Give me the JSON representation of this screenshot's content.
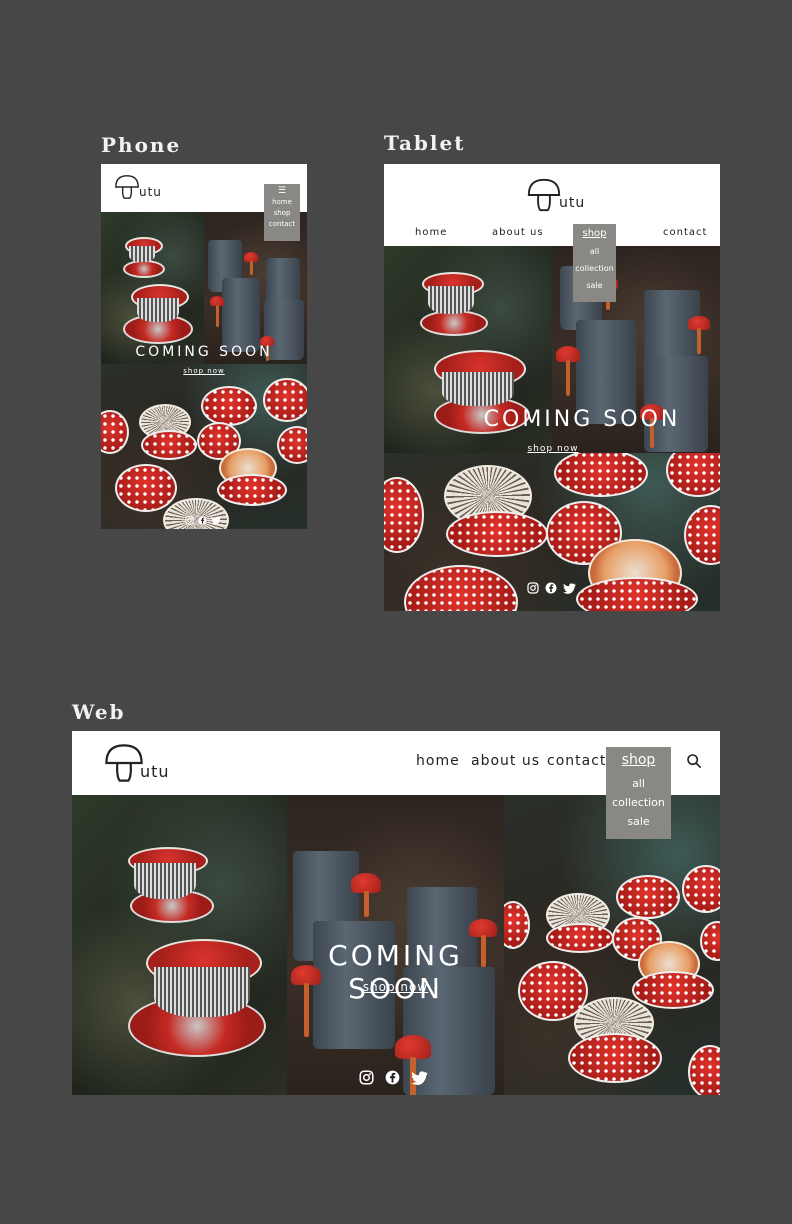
{
  "labels": {
    "phone": "Phone",
    "tablet": "Tablet",
    "web": "Web"
  },
  "brand": {
    "name": "utu"
  },
  "nav": {
    "home": "home",
    "about": "about us",
    "shop": "shop",
    "contact": "contact"
  },
  "menu_icon": "☰",
  "shop_menu": [
    "all",
    "collection",
    "sale"
  ],
  "phone_menu": [
    "home",
    "shop",
    "contact"
  ],
  "hero": {
    "title": "COMING SOON",
    "cta": "shop now"
  },
  "icons": [
    "instagram-icon",
    "facebook-icon",
    "twitter-icon",
    "search-icon",
    "menu-icon",
    "mushroom-logo-icon"
  ],
  "colors": {
    "background": "#474747",
    "header": "#ffffff",
    "dropdown": "#8a8884",
    "accent_red": "#c52a24"
  }
}
